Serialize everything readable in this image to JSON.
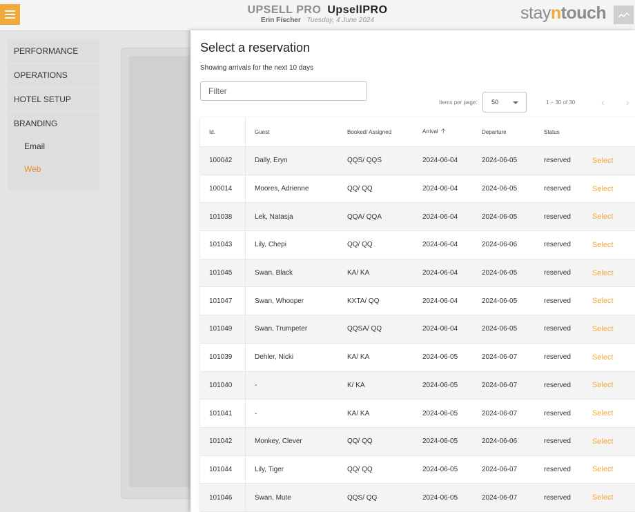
{
  "header": {
    "title_part1": "UPSELL PRO",
    "title_part2": "UpsellPRO",
    "user": "Erin Fischer",
    "date": "Tuesday, 4 June 2024",
    "logo_stay": "stay",
    "logo_n": "n",
    "logo_touch": "touch",
    "accent_color": "#f2a93b"
  },
  "sidebar": {
    "items": [
      {
        "label": "PERFORMANCE"
      },
      {
        "label": "OPERATIONS"
      },
      {
        "label": "HOTEL SETUP"
      },
      {
        "label": "BRANDING"
      }
    ],
    "subitems": [
      {
        "label": "Email"
      },
      {
        "label": "Web"
      }
    ]
  },
  "modal": {
    "title": "Select a reservation",
    "subtitle": "Showing arrivals for the next 10 days",
    "filter_placeholder": "Filter",
    "items_per_page_label": "Items per page:",
    "items_per_page_value": "50",
    "range_label": "1 – 30 of 30",
    "prev_icon": "‹",
    "next_icon": "›"
  },
  "table": {
    "headers": {
      "id": "Id.",
      "guest": "Guest",
      "booked": "Booked/ Assigned",
      "arrival": "Arrival",
      "departure": "Departure",
      "status": "Status"
    },
    "select_label": "Select",
    "rows": [
      {
        "id": "100042",
        "guest": "Dally, Eryn",
        "booked": "QQS/ QQS",
        "arrival": "2024-06-04",
        "departure": "2024-06-05",
        "status": "reserved"
      },
      {
        "id": "100014",
        "guest": "Moores, Adrienne",
        "booked": "QQ/ QQ",
        "arrival": "2024-06-04",
        "departure": "2024-06-05",
        "status": "reserved"
      },
      {
        "id": "101038",
        "guest": "Lek, Natasja",
        "booked": "QQA/ QQA",
        "arrival": "2024-06-04",
        "departure": "2024-06-05",
        "status": "reserved"
      },
      {
        "id": "101043",
        "guest": "Lily, Chepi",
        "booked": "QQ/ QQ",
        "arrival": "2024-06-04",
        "departure": "2024-06-06",
        "status": "reserved"
      },
      {
        "id": "101045",
        "guest": "Swan, Black",
        "booked": "KA/ KA",
        "arrival": "2024-06-04",
        "departure": "2024-06-05",
        "status": "reserved"
      },
      {
        "id": "101047",
        "guest": "Swan, Whooper",
        "booked": "KXTA/ QQ",
        "arrival": "2024-06-04",
        "departure": "2024-06-05",
        "status": "reserved"
      },
      {
        "id": "101049",
        "guest": "Swan, Trumpeter",
        "booked": "QQSA/ QQ",
        "arrival": "2024-06-04",
        "departure": "2024-06-05",
        "status": "reserved"
      },
      {
        "id": "101039",
        "guest": "Dehler, Nicki",
        "booked": "KA/ KA",
        "arrival": "2024-06-05",
        "departure": "2024-06-07",
        "status": "reserved"
      },
      {
        "id": "101040",
        "guest": "-",
        "booked": "K/ KA",
        "arrival": "2024-06-05",
        "departure": "2024-06-07",
        "status": "reserved"
      },
      {
        "id": "101041",
        "guest": "-",
        "booked": "KA/ KA",
        "arrival": "2024-06-05",
        "departure": "2024-06-07",
        "status": "reserved"
      },
      {
        "id": "101042",
        "guest": "Monkey, Clever",
        "booked": "QQ/ QQ",
        "arrival": "2024-06-05",
        "departure": "2024-06-06",
        "status": "reserved"
      },
      {
        "id": "101044",
        "guest": "Lily, Tiger",
        "booked": "QQ/ QQ",
        "arrival": "2024-06-05",
        "departure": "2024-06-07",
        "status": "reserved"
      },
      {
        "id": "101046",
        "guest": "Swan, Mute",
        "booked": "QQS/ QQ",
        "arrival": "2024-06-05",
        "departure": "2024-06-07",
        "status": "reserved"
      }
    ]
  }
}
